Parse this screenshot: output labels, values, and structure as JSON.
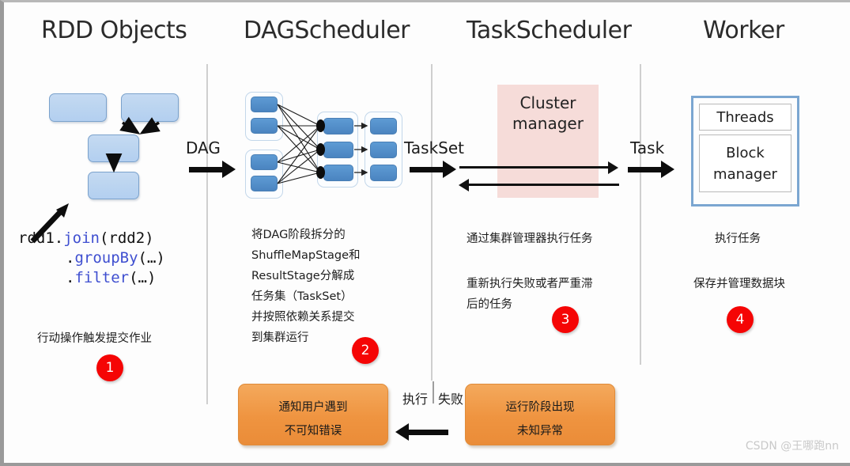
{
  "columns": [
    {
      "id": "rdd-objects",
      "title": "RDD Objects"
    },
    {
      "id": "dag-scheduler",
      "title": "DAGScheduler"
    },
    {
      "id": "task-scheduler",
      "title": "TaskScheduler"
    },
    {
      "id": "worker",
      "title": "Worker"
    }
  ],
  "flow_labels": {
    "dag": "DAG",
    "taskset": "TaskSet",
    "task": "Task",
    "execute": "执行",
    "fail": "失败"
  },
  "code": {
    "line1_prefix": "rdd1.",
    "line1_method": "join",
    "line1_suffix": "(rdd2)",
    "line2_dot": ".",
    "line2_method": "groupBy",
    "line2_suffix": "(…)",
    "line3_dot": ".",
    "line3_method": "filter",
    "line3_suffix": "(…)"
  },
  "descriptions": {
    "rdd": [
      "行动操作触发提交作业"
    ],
    "dag": [
      "将DAG阶段拆分的",
      "ShuffleMapStage和",
      "ResultStage分解成",
      "任务集（TaskSet）",
      "并按照依赖关系提交",
      "到集群运行"
    ],
    "task_scheduler": [
      "通过集群管理器执行任务",
      "重新执行失败或者严重滞",
      "后的任务"
    ],
    "worker": [
      "执行任务",
      "保存并管理数据块"
    ]
  },
  "badges": [
    {
      "number": "1"
    },
    {
      "number": "2"
    },
    {
      "number": "3"
    },
    {
      "number": "4"
    }
  ],
  "cluster_manager": {
    "line1": "Cluster",
    "line2": "manager"
  },
  "worker_box": {
    "threads": "Threads",
    "block_line1": "Block",
    "block_line2": "manager"
  },
  "error_boxes": {
    "left_line1": "通知用户遇到",
    "left_line2": "不可知错误",
    "right_line1": "运行阶段出现",
    "right_line2": "未知异常"
  },
  "watermark": "CSDN @王哪跑nn",
  "colors": {
    "rdd_box_fill": "#bcd5f0",
    "rdd_box_border": "#7ba2cc",
    "dag_node_fill": "#4a84c0",
    "cluster_manager_fill": "#f6dcd9",
    "worker_border": "#7ba6d1",
    "orange_fill": "#ef9440",
    "badge_red": "#f50505",
    "divider_gray": "#cfcfcf",
    "code_method_blue": "#3f4fd0"
  }
}
